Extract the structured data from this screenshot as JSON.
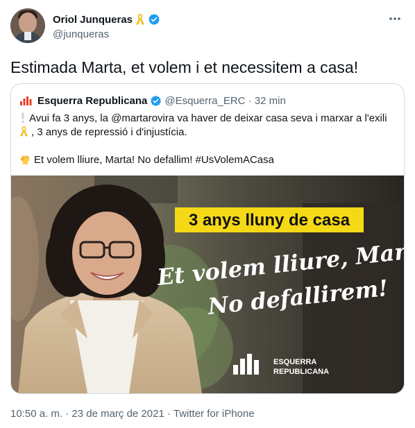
{
  "author": {
    "name": "Oriol Junqueras",
    "handle": "@junqueras",
    "avatar_icon": "profile-photo",
    "badge_icons": [
      "yellow-ribbon-icon",
      "verified-badge-icon"
    ]
  },
  "menu": {
    "icon": "more-horizontal-icon"
  },
  "tweet": {
    "text": "Estimada Marta, et volem i et necessitem a casa!"
  },
  "quote": {
    "name": "Esquerra Republicana",
    "handle_time": "@Esquerra_ERC · 32 min",
    "logo_icon": "erc-logo-icon",
    "line1": "Avui fa 3 anys, la @martarovira va haver de deixar casa seva i marxar a l'exili",
    "line2": ", 3 anys de repressió i d'injustícia.",
    "line3": "Et volem lliure, Marta! No defallim! #UsVolemACasa",
    "emoji_icons": [
      "exclamation-mark-icon",
      "yellow-ribbon-icon",
      "raised-fist-icon"
    ]
  },
  "image": {
    "banner": "3 anys lluny de casa",
    "script_line1": "Et volem lliure, Marta!",
    "script_line2": "No defallirem!",
    "logo_line1": "ESQUERRA",
    "logo_line2": "REPUBLICANA",
    "colors": {
      "banner_bg": "#f5d916",
      "banner_text": "#111111",
      "script_text": "#ffffff"
    }
  },
  "meta": {
    "timestamp": "10:50 a. m. · 23 de març de 2021 · Twitter for iPhone"
  }
}
